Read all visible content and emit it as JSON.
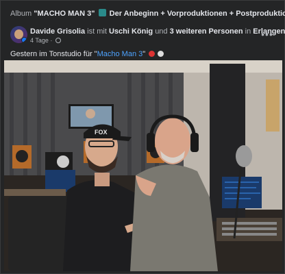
{
  "album": {
    "prefix": "Album",
    "title": "\"MACHO MAN 3\"",
    "rest": "Der Anbeginn + Vorproduktionen + Postproduktion"
  },
  "post": {
    "author": "Davide Grisolia",
    "connector1": "ist mit",
    "tagged": "Uschi König",
    "connector2": "und",
    "others": "3 weiteren Personen",
    "connector3": "in",
    "location": "Erlangen",
    "suffix": ".",
    "time": "4 Tage",
    "dot": "·",
    "more_label": "•••"
  },
  "caption": {
    "text": "Gestern im Tonstudio für \"",
    "link": "Macho Man 3",
    "close": "\""
  },
  "photo": {
    "cap_text": "FOX"
  },
  "icons": {
    "album_emoji": "mountain-emoji-icon",
    "globe": "globe-icon",
    "more": "more-options-icon",
    "emoji1": "boxing-glove-emoji-icon",
    "emoji2": "helmet-emoji-icon"
  }
}
